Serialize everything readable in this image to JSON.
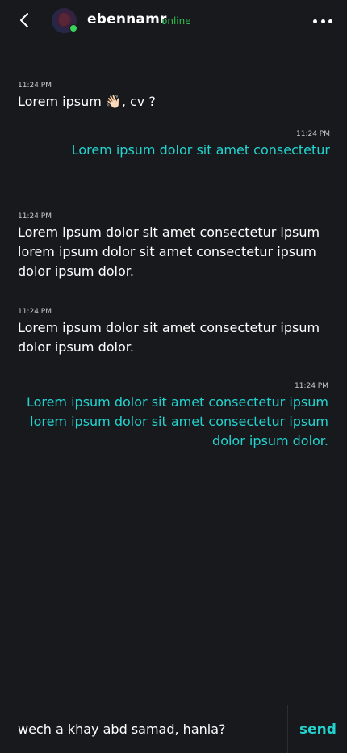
{
  "header": {
    "username": "ebennamr",
    "status": "online"
  },
  "messages": [
    {
      "direction": "in",
      "time": "11:24 PM",
      "text": "Lorem ipsum 👋🏻, cv ?"
    },
    {
      "direction": "out",
      "time": "11:24 PM",
      "text": "Lorem ipsum dolor sit amet consectetur"
    },
    {
      "direction": "in",
      "time": "11:24 PM",
      "text": "Lorem ipsum dolor sit amet consectetur ipsum lorem ipsum dolor sit amet consectetur ipsum dolor ipsum dolor."
    },
    {
      "direction": "in",
      "time": "11:24 PM",
      "text": "Lorem ipsum dolor sit amet consectetur ipsum dolor ipsum dolor."
    },
    {
      "direction": "out",
      "time": "11:24 PM",
      "text": "Lorem ipsum dolor sit amet consectetur ipsum lorem ipsum dolor sit amet consectetur ipsum dolor ipsum dolor."
    }
  ],
  "composer": {
    "value": "wech a khay abd samad, hania?",
    "send_label": "send"
  },
  "colors": {
    "background": "#18191d",
    "incoming_text": "#ffffff",
    "outgoing_text": "#22d3cf",
    "online": "#2fbf4f",
    "divider": "#2c2e33"
  }
}
